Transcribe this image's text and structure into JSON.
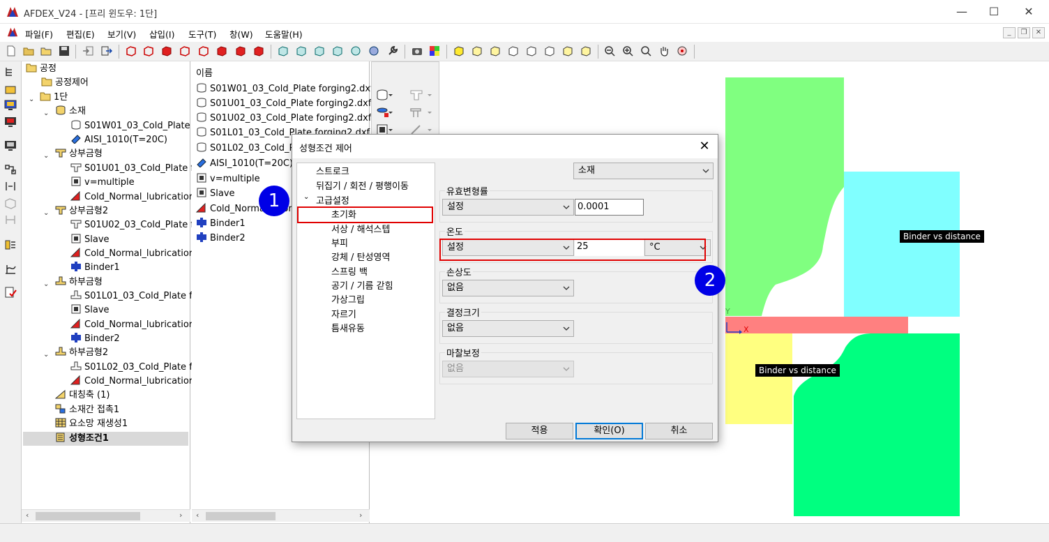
{
  "window": {
    "title": "AFDEX_V24 - [프리 윈도우: 1단]"
  },
  "menu": [
    "파일(F)",
    "편집(E)",
    "보기(V)",
    "삽입(I)",
    "도구(T)",
    "창(W)",
    "도움말(H)"
  ],
  "tree": [
    "공정",
    "공정제어",
    "1단",
    "소재",
    "S01W01_03_Cold_Plate",
    "AISI_1010(T=20C)",
    "상부금형",
    "S01U01_03_Cold_Plate f",
    "v=multiple",
    "Cold_Normal_lubricatior",
    "상부금형2",
    "S01U02_03_Cold_Plate f",
    "Slave",
    "Cold_Normal_lubricatior",
    "Binder1",
    "하부금형",
    "S01L01_03_Cold_Plate f",
    "Slave",
    "Cold_Normal_lubricatior",
    "Binder2",
    "하부금형2",
    "S01L02_03_Cold_Plate f",
    "Cold_Normal_lubricatior",
    "대칭축 (1)",
    "소재간 접촉1",
    "요소망 재생성1",
    "성형조건1"
  ],
  "list": {
    "header": "이름",
    "items": [
      "S01W01_03_Cold_Plate forging2.dxf",
      "S01U01_03_Cold_Plate forging2.dxf",
      "S01U02_03_Cold_Plate forging2.dxf",
      "S01L01_03_Cold_Plate forging2.dxf",
      "S01L02_03_Cold_Pl",
      "AISI_1010(T=20C)",
      "v=multiple",
      "Slave",
      "Cold_Normal_Lubric",
      "Binder1",
      "Binder2"
    ]
  },
  "viewport": {
    "label_upper": "Binder vs distance",
    "label_lower": "Binder vs distance",
    "axis_y": "Y",
    "axis_x": "X"
  },
  "dialog": {
    "title": "성형조건 제어",
    "tree": [
      "스트로크",
      "뒤집기 / 회전 / 평행이동",
      "고급설정",
      "초기화",
      "서상 / 해석스텝",
      "부피",
      "강체 / 탄성영역",
      "스프링 백",
      "공기 / 기름 갇힘",
      "가상그립",
      "자르기",
      "틈새유동"
    ],
    "target_select": "소재",
    "groups": {
      "strain_rate": {
        "label": "유효변형률",
        "mode": "설정",
        "value": "0.0001"
      },
      "temperature": {
        "label": "온도",
        "mode": "설정",
        "value": "25",
        "unit": "°C"
      },
      "damage": {
        "label": "손상도",
        "mode": "없음"
      },
      "grain": {
        "label": "결정크기",
        "mode": "없음"
      },
      "friction": {
        "label": "마찰보정",
        "mode": "없음"
      }
    },
    "buttons": {
      "apply": "적용",
      "ok": "확인(O)",
      "cancel": "취소"
    }
  },
  "markers": [
    "1",
    "2"
  ],
  "colors": {
    "upper_die": "#80ff80",
    "upper_die2": "#80ffff",
    "material": "#ff8080",
    "lower_die": "#ffff80",
    "lower_die2": "#00ff80",
    "highlight": "#e00000",
    "marker": "#0000e6"
  }
}
